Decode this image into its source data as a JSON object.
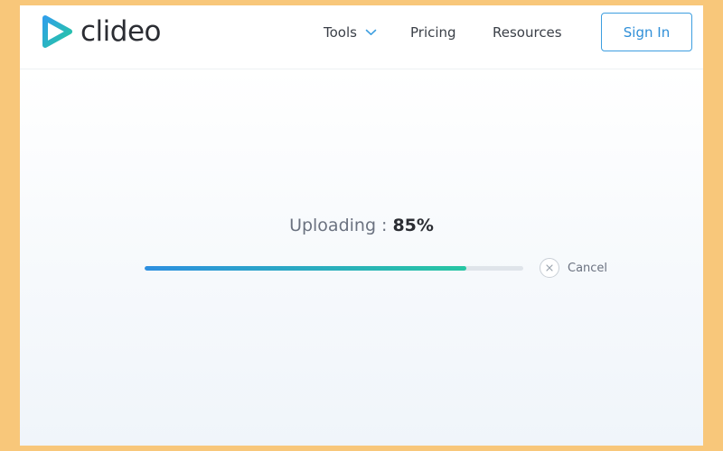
{
  "app": {
    "name": "clideo"
  },
  "nav": {
    "tools": "Tools",
    "pricing": "Pricing",
    "resources": "Resources",
    "sign_in": "Sign In"
  },
  "upload": {
    "label": "Uploading",
    "separator": ":",
    "percent_text": "85%",
    "progress_fraction": 0.85,
    "cancel": "Cancel"
  },
  "colors": {
    "frame": "#f8c77a",
    "accent_blue": "#2d8fe0",
    "accent_green": "#27c6a3",
    "text_dark": "#2b2d33"
  },
  "icons": {
    "logo": "play-triangle-icon",
    "tools_dropdown": "chevron-down-icon",
    "cancel": "close-icon"
  }
}
